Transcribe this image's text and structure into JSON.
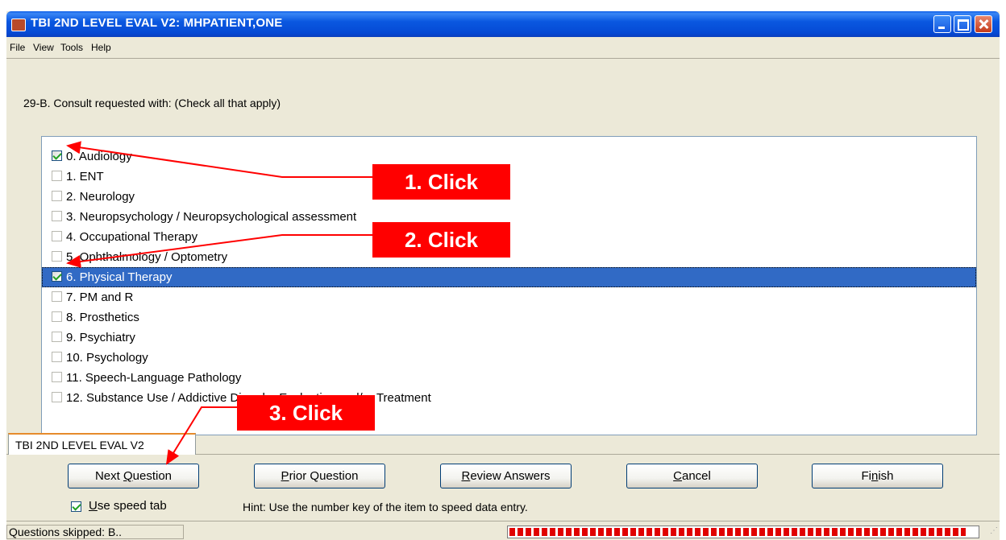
{
  "window": {
    "title": "TBI 2ND LEVEL EVAL V2: MHPATIENT,ONE"
  },
  "menu": [
    "File",
    "View",
    "Tools",
    "Help"
  ],
  "question": "29-B. Consult requested with: (Check all that apply)",
  "items": [
    {
      "label": "0. Audiology",
      "checked": true,
      "selected": false
    },
    {
      "label": "1. ENT",
      "checked": false,
      "selected": false
    },
    {
      "label": "2. Neurology",
      "checked": false,
      "selected": false
    },
    {
      "label": "3. Neuropsychology / Neuropsychological assessment",
      "checked": false,
      "selected": false
    },
    {
      "label": "4. Occupational Therapy",
      "checked": false,
      "selected": false
    },
    {
      "label": "5. Ophthalmology / Optometry",
      "checked": false,
      "selected": false
    },
    {
      "label": "6. Physical Therapy",
      "checked": true,
      "selected": true
    },
    {
      "label": "7. PM and R",
      "checked": false,
      "selected": false
    },
    {
      "label": "8. Prosthetics",
      "checked": false,
      "selected": false
    },
    {
      "label": "9. Psychiatry",
      "checked": false,
      "selected": false
    },
    {
      "label": "10. Psychology",
      "checked": false,
      "selected": false
    },
    {
      "label": "11. Speech-Language Pathology",
      "checked": false,
      "selected": false
    },
    {
      "label": "12. Substance Use / Addictive Disorder Evaluation and/or Treatment",
      "checked": false,
      "selected": false
    }
  ],
  "tab_label": "TBI 2ND LEVEL EVAL V2",
  "buttons": {
    "next": {
      "pre": "Next ",
      "key": "Q",
      "post": "uestion"
    },
    "prior": {
      "pre": "",
      "key": "P",
      "post": "rior Question"
    },
    "review": {
      "pre": "",
      "key": "R",
      "post": "eview Answers"
    },
    "cancel": {
      "pre": "",
      "key": "C",
      "post": "ancel"
    },
    "finish": {
      "pre": "Fi",
      "key": "n",
      "post": "ish"
    }
  },
  "speed_tab": {
    "pre": "",
    "key": "U",
    "post": "se speed tab",
    "checked": true
  },
  "hint": "Hint: Use the number key of the item to speed data entry.",
  "status": "Questions skipped: B..",
  "progress_fraction": 0.98,
  "callouts": [
    "1. Click",
    "2. Click",
    "3. Click"
  ],
  "colors": {
    "accent": "#316ac5",
    "callout": "#ff0000",
    "titlebar": "#0a58e0"
  }
}
